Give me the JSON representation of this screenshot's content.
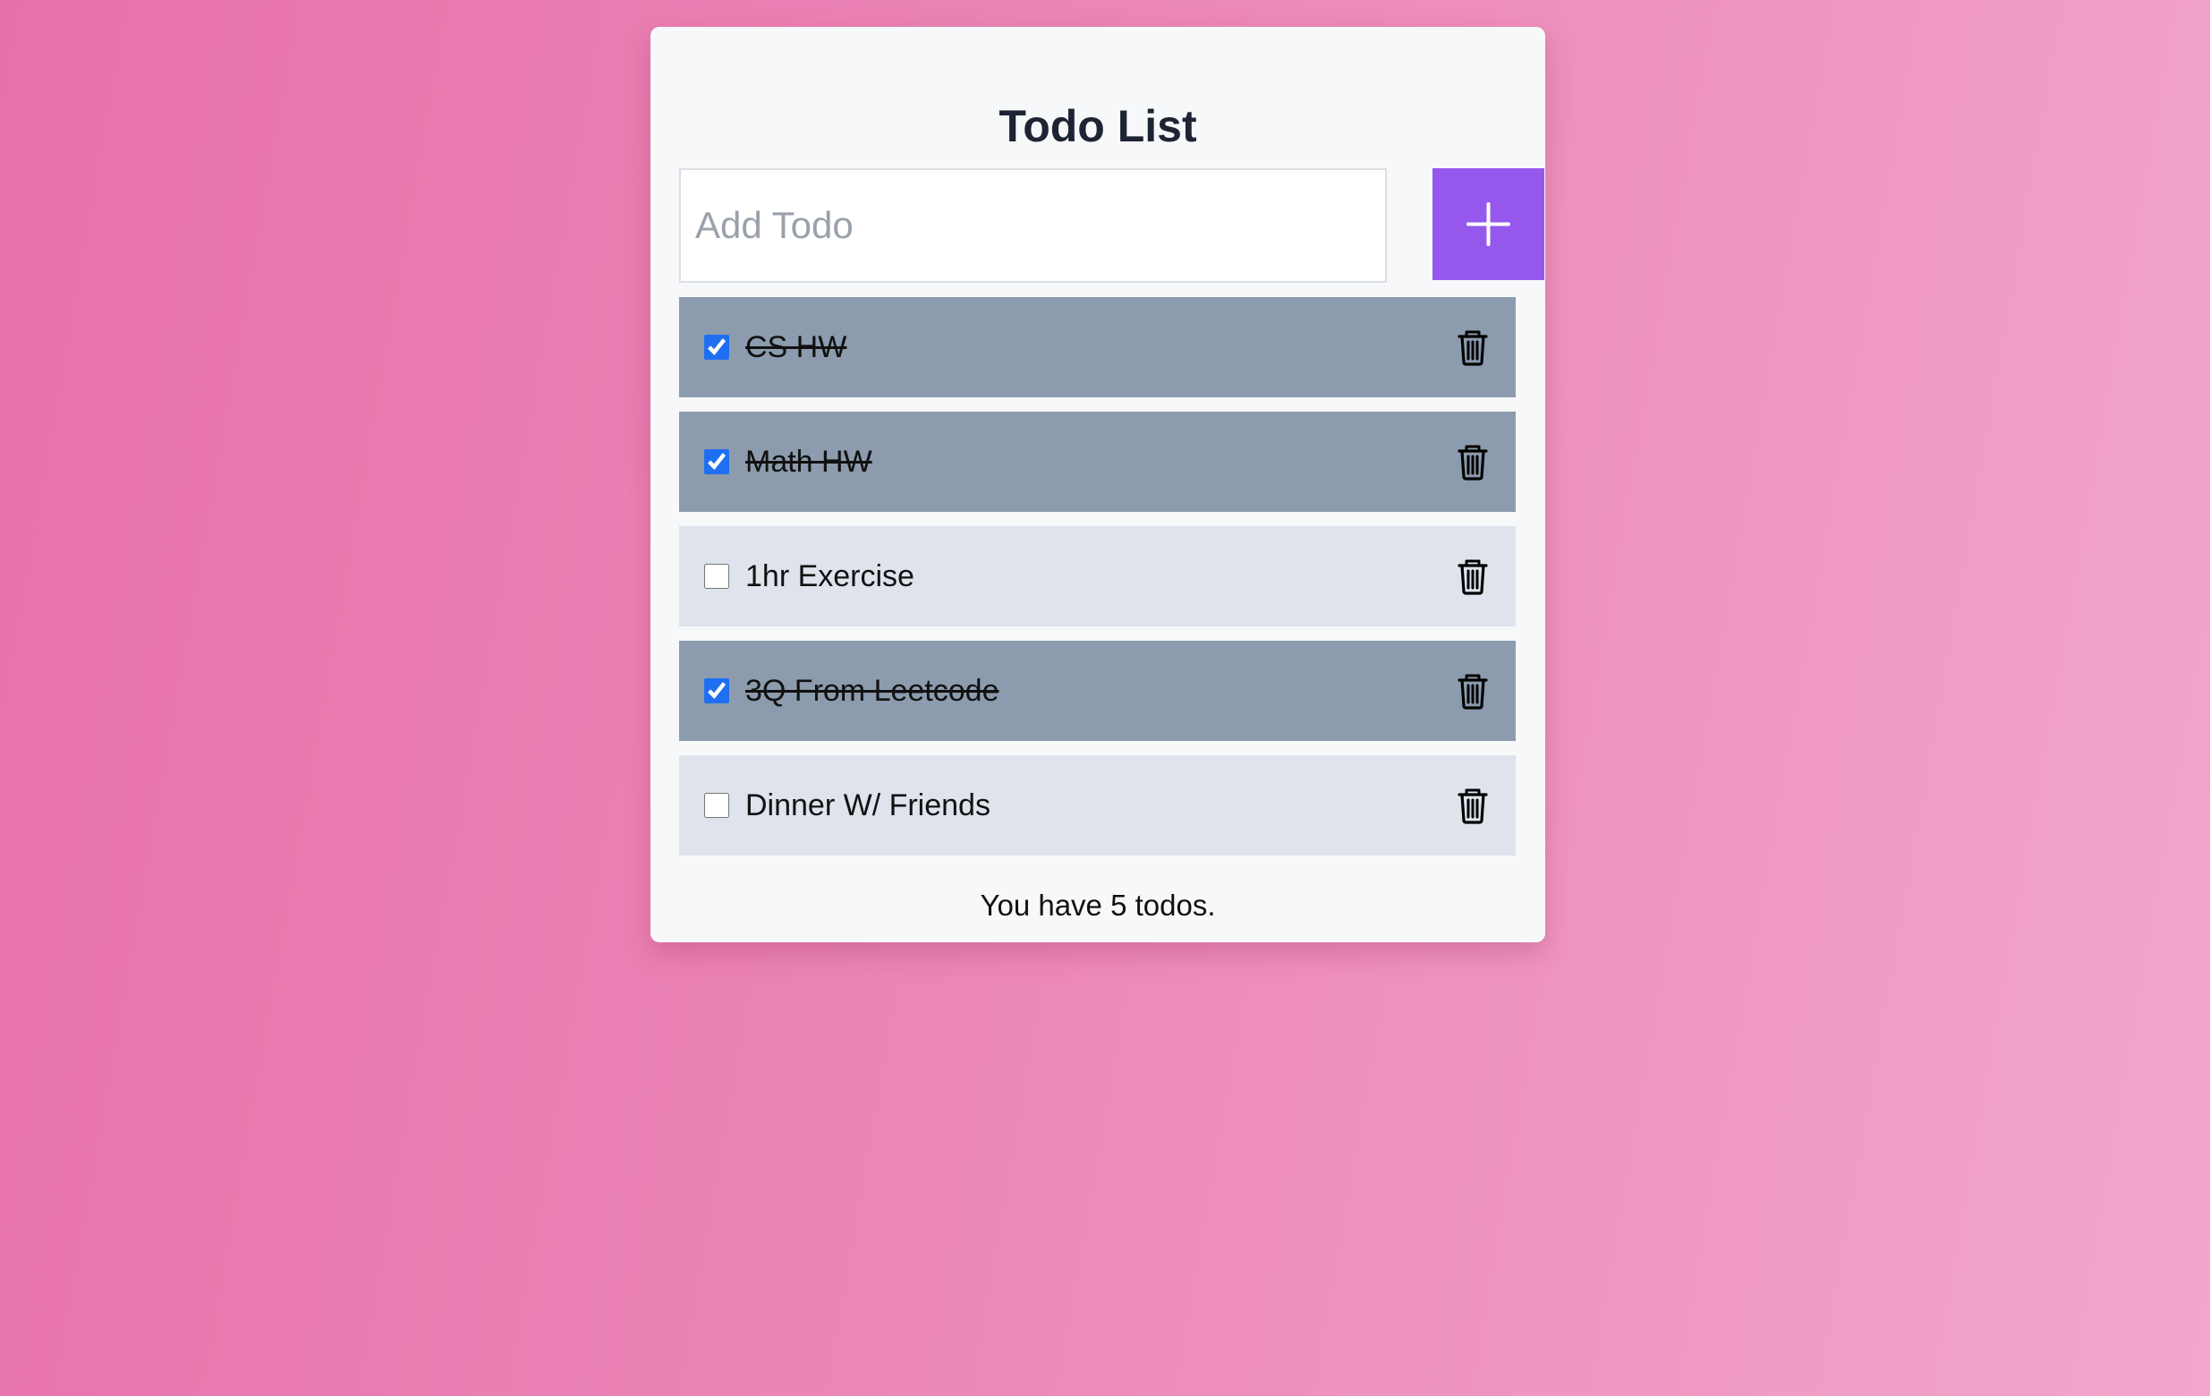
{
  "app": {
    "title": "Todo List"
  },
  "add_form": {
    "placeholder": "Add Todo",
    "value": "",
    "button_icon": "plus-icon",
    "button_color": "#9658ec"
  },
  "todos": [
    {
      "label": "CS HW",
      "completed": true
    },
    {
      "label": "Math HW",
      "completed": true
    },
    {
      "label": "1hr Exercise",
      "completed": false
    },
    {
      "label": "3Q From Leetcode",
      "completed": true
    },
    {
      "label": "Dinner W/ Friends",
      "completed": false
    }
  ],
  "todo_item": {
    "delete_icon": "trash-icon",
    "completed_color": "#8c9bad",
    "pending_color": "#dee3ec"
  },
  "footer": {
    "summary": "You have 5 todos."
  }
}
